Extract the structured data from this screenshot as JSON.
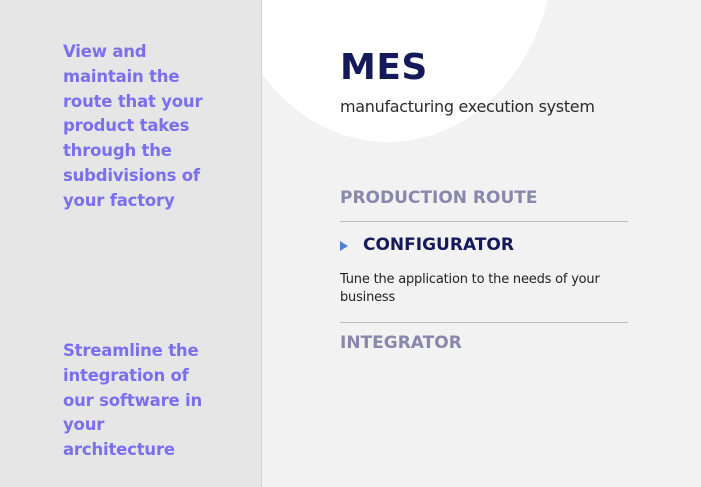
{
  "left_panel": {
    "route_blurb": "View and maintain the route that your product takes through the subdivisions of your factory",
    "integration_blurb": "Streamline the integration of our software in your architecture"
  },
  "brand": {
    "title": "MES",
    "subtitle": "manufacturing execution system"
  },
  "menu": {
    "production_route": "PRODUCTION ROUTE",
    "configurator": {
      "label": "CONFIGURATOR",
      "description": "Tune the application to the needs of your business"
    },
    "integrator": "INTEGRATOR"
  },
  "colors": {
    "accent_purple": "#7b6ff0",
    "navy": "#14195a",
    "muted_heading": "#8a87ad",
    "arrow_blue": "#4f7fd6"
  },
  "icons": {
    "active_marker": "play-arrow-icon"
  }
}
